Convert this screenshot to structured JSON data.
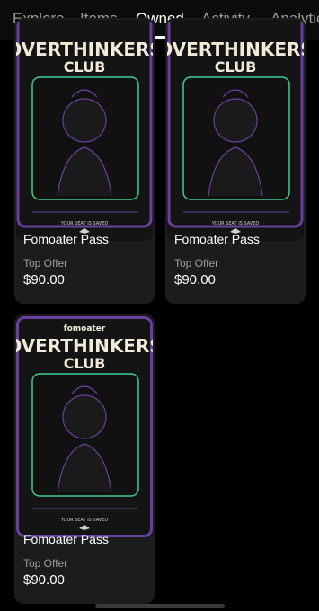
{
  "tabs": [
    {
      "label": "Explore"
    },
    {
      "label": "Items"
    },
    {
      "label": "Owned"
    },
    {
      "label": "Activity"
    },
    {
      "label": "Analytics"
    }
  ],
  "active_tab": "Owned",
  "poster": {
    "brand": "fomoater",
    "title_line1": "OVERTHINKERS",
    "title_line2": "CLUB",
    "caption": "YOUR SEAT IS SAVED"
  },
  "cards": [
    {
      "name": "Fomoater Pass",
      "offer_label": "Top Offer",
      "price": "$90.00"
    },
    {
      "name": "Fomoater Pass",
      "offer_label": "Top Offer",
      "price": "$90.00"
    },
    {
      "name": "Fomoater Pass",
      "offer_label": "Top Offer",
      "price": "$90.00"
    }
  ],
  "colors": {
    "background": "#000000",
    "card": "#1c1c1e",
    "poster_border": "#6b3fa0",
    "poster_frame": "#3ecf8e",
    "poster_title": "#f2ead8"
  }
}
